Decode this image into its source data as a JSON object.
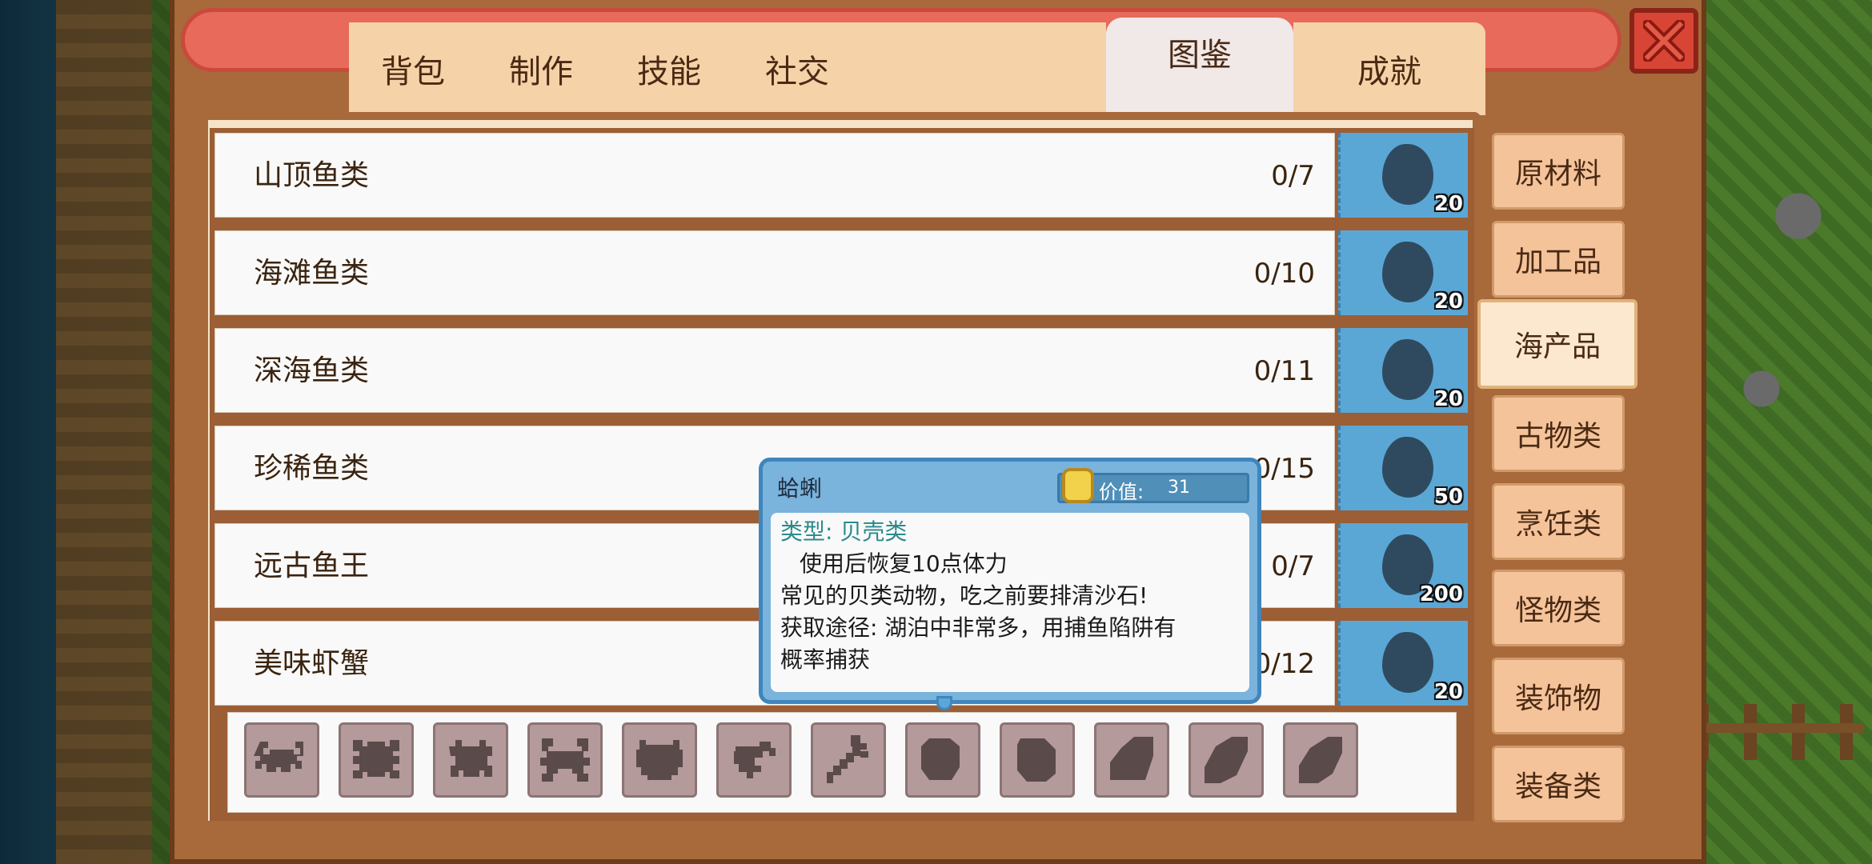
{
  "tabs": [
    {
      "label": "背包"
    },
    {
      "label": "制作"
    },
    {
      "label": "技能"
    },
    {
      "label": "社交"
    },
    {
      "label": "图鉴",
      "active": true
    },
    {
      "label": "成就"
    }
  ],
  "categories": [
    {
      "label": "原材料"
    },
    {
      "label": "加工品"
    },
    {
      "label": "海产品",
      "active": true
    },
    {
      "label": "古物类"
    },
    {
      "label": "烹饪类"
    },
    {
      "label": "怪物类"
    },
    {
      "label": "装饰物"
    },
    {
      "label": "装备类"
    }
  ],
  "rows": [
    {
      "name": "山顶鱼类",
      "count": "0/7",
      "reward": "20"
    },
    {
      "name": "海滩鱼类",
      "count": "0/10",
      "reward": "20"
    },
    {
      "name": "深海鱼类",
      "count": "0/11",
      "reward": "20"
    },
    {
      "name": "珍稀鱼类",
      "count": "0/15",
      "reward": "50"
    },
    {
      "name": "远古鱼王",
      "count": "0/7",
      "reward": "200"
    },
    {
      "name": "美味虾蟹",
      "count": "0/12",
      "reward": "20"
    }
  ],
  "items": [
    {
      "icon": "crab-silhouette-icon"
    },
    {
      "icon": "crab-silhouette-icon"
    },
    {
      "icon": "crab-silhouette-icon"
    },
    {
      "icon": "crab-silhouette-icon"
    },
    {
      "icon": "crab-silhouette-icon"
    },
    {
      "icon": "shrimp-silhouette-icon"
    },
    {
      "icon": "lobster-silhouette-icon"
    },
    {
      "icon": "shell-silhouette-icon"
    },
    {
      "icon": "shell-silhouette-icon"
    },
    {
      "icon": "shell-silhouette-icon"
    },
    {
      "icon": "shell-silhouette-icon"
    },
    {
      "icon": "shell-silhouette-icon"
    }
  ],
  "tooltip": {
    "name": "蛤蜊",
    "value_label": "价值:",
    "value": "31",
    "type_line": "类型: 贝壳类",
    "effect_line": "使用后恢复10点体力",
    "desc_line": "常见的贝类动物，吃之前要排清沙石!",
    "source_line1": "获取途径: 湖泊中非常多，用捕鱼陷阱有",
    "source_line2": "概率捕获"
  },
  "colors": {
    "tab_bg": "#f6d2a8",
    "frame_brown": "#a8693b",
    "reward_blue": "#5aa7d6",
    "close_red": "#d94535"
  }
}
